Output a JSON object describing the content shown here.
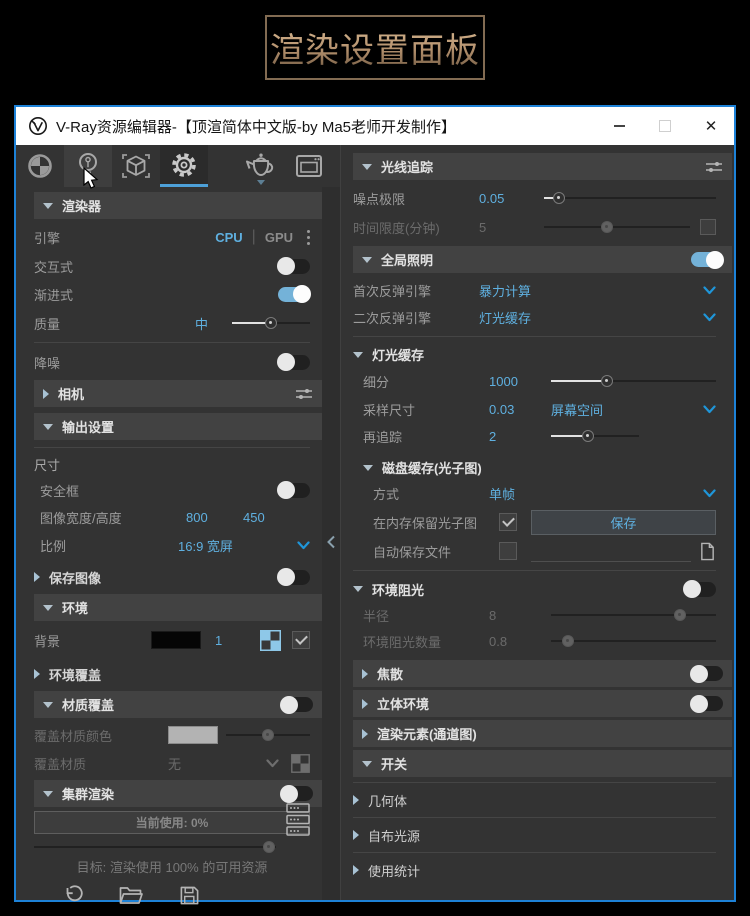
{
  "poster": {
    "title": "渲染设置面板"
  },
  "titlebar": {
    "app_title": "V-Ray资源编辑器-【顶渲简体中文版-by Ma5老师开发制作】",
    "close_glyph": "✕"
  },
  "left": {
    "renderer": {
      "title": "渲染器"
    },
    "engine": {
      "label": "引擎",
      "cpu": "CPU",
      "sep": "|",
      "gpu": "GPU"
    },
    "interactive": {
      "label": "交互式"
    },
    "progressive": {
      "label": "渐进式"
    },
    "quality": {
      "label": "质量",
      "value": "中"
    },
    "denoise": {
      "label": "降噪"
    },
    "camera": {
      "title": "相机"
    },
    "output": {
      "title": "输出设置"
    },
    "size_group": {
      "label": "尺寸"
    },
    "safe_frame": {
      "label": "安全框"
    },
    "image_size": {
      "label": "图像宽度/高度",
      "width": "800",
      "height": "450"
    },
    "ratio": {
      "label": "比例",
      "value": "16:9 宽屏"
    },
    "save_image": {
      "title": "保存图像"
    },
    "environment": {
      "title": "环境"
    },
    "background": {
      "label": "背景",
      "value": "1"
    },
    "env_override": {
      "title": "环境覆盖"
    },
    "mat_override": {
      "title": "材质覆盖"
    },
    "override_color": {
      "label": "覆盖材质颜色"
    },
    "override_mat": {
      "label": "覆盖材质",
      "value": "无"
    },
    "swarm": {
      "title": "集群渲染",
      "usage": "当前使用: 0%",
      "goal": "目标: 渲染使用 100% 的可用资源"
    }
  },
  "right": {
    "raytrace": {
      "title": "光线追踪"
    },
    "noise_limit": {
      "label": "噪点极限",
      "value": "0.05"
    },
    "time_limit": {
      "label": "时间限度(分钟)",
      "value": "5"
    },
    "gi": {
      "title": "全局照明"
    },
    "primary_engine": {
      "label": "首次反弹引擎",
      "value": "暴力计算"
    },
    "secondary_engine": {
      "label": "二次反弹引擎",
      "value": "灯光缓存"
    },
    "light_cache": {
      "title": "灯光缓存"
    },
    "subdivs": {
      "label": "细分",
      "value": "1000"
    },
    "sample_size": {
      "label": "采样尺寸",
      "value": "0.03",
      "space": "屏幕空间"
    },
    "retrace": {
      "label": "再追踪",
      "value": "2"
    },
    "disk_cache": {
      "title": "磁盘缓存(光子图)"
    },
    "mode": {
      "label": "方式",
      "value": "单帧"
    },
    "keep_map": {
      "label": "在内存保留光子图",
      "button": "保存"
    },
    "autosave": {
      "label": "自动保存文件"
    },
    "ao": {
      "title": "环境阻光"
    },
    "radius": {
      "label": "半径",
      "value": "8"
    },
    "ao_amount": {
      "label": "环境阻光数量",
      "value": "0.8"
    },
    "caustics": {
      "title": "焦散"
    },
    "stereo": {
      "title": "立体环境"
    },
    "render_elements": {
      "title": "渲染元素(通道图)"
    },
    "switches": {
      "title": "开关"
    },
    "geometry": {
      "title": "几何体"
    },
    "self_lights": {
      "title": "自布光源"
    },
    "usage_stats": {
      "title": "使用统计"
    }
  },
  "colors": {
    "accent_blue": "#5fb0e0",
    "chevron_blue": "#1f96d9",
    "toggle_on": "#74b2d8",
    "window_border": "#1d82d8",
    "tab_underline": "#4da0d8",
    "poster_gold": "#b28f6c",
    "panel_bg": "#333333",
    "header_bar_bg": "#424242"
  }
}
